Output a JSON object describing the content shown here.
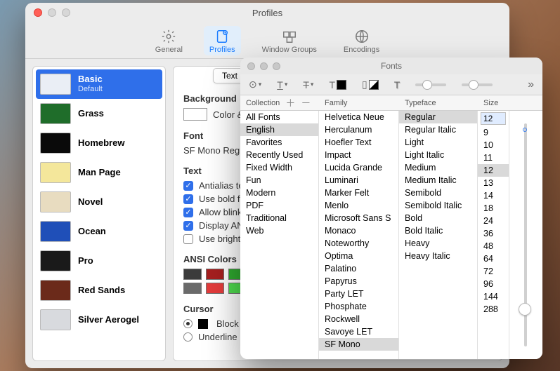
{
  "profiles_window": {
    "title": "Profiles",
    "tabs": [
      {
        "label": "General"
      },
      {
        "label": "Profiles"
      },
      {
        "label": "Window Groups"
      },
      {
        "label": "Encodings"
      }
    ],
    "selected_tab": 1,
    "profiles": [
      {
        "name": "Basic",
        "sub": "Default",
        "thumb_bg": "#eaeef5"
      },
      {
        "name": "Grass",
        "thumb_bg": "#1f6d2a"
      },
      {
        "name": "Homebrew",
        "thumb_bg": "#0a0a0a"
      },
      {
        "name": "Man Page",
        "thumb_bg": "#f4e79b"
      },
      {
        "name": "Novel",
        "thumb_bg": "#e8dcc0"
      },
      {
        "name": "Ocean",
        "thumb_bg": "#1f4fb8"
      },
      {
        "name": "Pro",
        "thumb_bg": "#1a1a1a"
      },
      {
        "name": "Red Sands",
        "thumb_bg": "#6b2a1a"
      },
      {
        "name": "Silver Aerogel",
        "thumb_bg": "#d8dade"
      }
    ],
    "selected_profile": 0,
    "detail": {
      "tab_label": "Text",
      "background_heading": "Background",
      "color_effects_label": "Color & Effects",
      "font_heading": "Font",
      "font_value": "SF Mono Regular",
      "text_heading": "Text",
      "checks": [
        {
          "label": "Antialias text",
          "on": true
        },
        {
          "label": "Use bold fonts",
          "on": true
        },
        {
          "label": "Allow blinking text",
          "on": true
        },
        {
          "label": "Display ANSI colors",
          "on": true
        },
        {
          "label": "Use bright colors",
          "on": false
        }
      ],
      "ansi_heading": "ANSI Colors",
      "ansi_row1": [
        "#3b3b3b",
        "#a51f1f",
        "#2faa2f"
      ],
      "ansi_row2": [
        "#6a6a6a",
        "#e23b3b",
        "#4fdc4f"
      ],
      "cursor_heading": "Cursor",
      "cursor_opts": [
        {
          "label": "Block",
          "on": true
        },
        {
          "label": "Underline",
          "on": false
        }
      ]
    }
  },
  "fonts_window": {
    "title": "Fonts",
    "headers": {
      "collection": "Collection",
      "family": "Family",
      "typeface": "Typeface",
      "size": "Size"
    },
    "collections": [
      "All Fonts",
      "English",
      "Favorites",
      "Recently Used",
      "Fixed Width",
      "Fun",
      "Modern",
      "PDF",
      "Traditional",
      "Web"
    ],
    "collection_sel": 1,
    "families": [
      "Helvetica Neue",
      "Herculanum",
      "Hoefler Text",
      "Impact",
      "Lucida Grande",
      "Luminari",
      "Marker Felt",
      "Menlo",
      "Microsoft Sans S",
      "Monaco",
      "Noteworthy",
      "Optima",
      "Palatino",
      "Papyrus",
      "Party LET",
      "Phosphate",
      "Rockwell",
      "Savoye LET",
      "SF Mono"
    ],
    "family_sel": 18,
    "typefaces": [
      "Regular",
      "Regular Italic",
      "Light",
      "Light Italic",
      "Medium",
      "Medium Italic",
      "Semibold",
      "Semibold Italic",
      "Bold",
      "Bold Italic",
      "Heavy",
      "Heavy Italic"
    ],
    "typeface_sel": 0,
    "size_value": "12",
    "sizes": [
      "9",
      "10",
      "11",
      "12",
      "13",
      "14",
      "18",
      "24",
      "36",
      "48",
      "64",
      "72",
      "96",
      "144",
      "288"
    ],
    "size_sel": 3
  }
}
